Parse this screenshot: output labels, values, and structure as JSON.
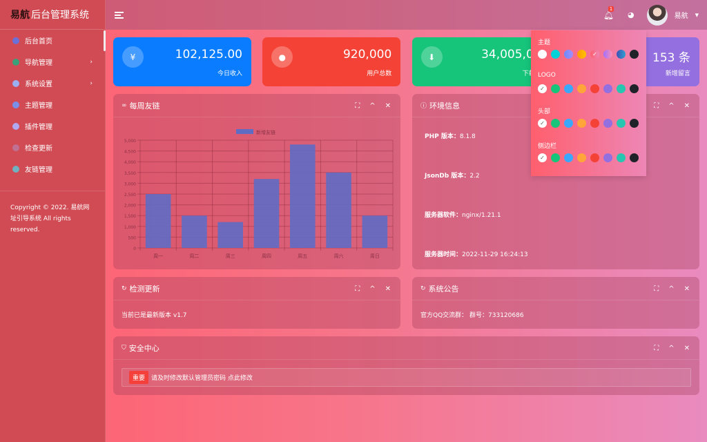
{
  "sidebar": {
    "brand": "易航",
    "title": "后台管理系统",
    "items": [
      {
        "label": "后台首页",
        "icon": "home-icon",
        "color": "#6b70d8"
      },
      {
        "label": "导航管理",
        "icon": "navigation-icon",
        "color": "#3aa07a",
        "chevron": "›"
      },
      {
        "label": "系统设置",
        "icon": "settings-icon",
        "color": "#9ab0f0",
        "chevron": "›"
      },
      {
        "label": "主题管理",
        "icon": "theme-icon",
        "color": "#7a8fe8"
      },
      {
        "label": "插件管理",
        "icon": "plugin-icon",
        "color": "#b0a8f0"
      },
      {
        "label": "检查更新",
        "icon": "clock-icon",
        "color": "#c07090"
      },
      {
        "label": "友链管理",
        "icon": "link-icon",
        "color": "#70b0c0"
      }
    ],
    "copyright": "Copyright © 2022. 易航网址引导系统 All rights reserved."
  },
  "header": {
    "notification_count": "1",
    "username": "易航"
  },
  "cards": [
    {
      "value": "102,125.00",
      "label": "今日收入",
      "icon": "yen-icon",
      "glyph": "¥",
      "color": "#0a7cff"
    },
    {
      "value": "920,000",
      "label": "用户总数",
      "icon": "user-icon",
      "glyph": "●",
      "color": "#f44336"
    },
    {
      "value": "34,005,00",
      "label": "下载总",
      "icon": "download-icon",
      "glyph": "⬇",
      "color": "#16c47a"
    },
    {
      "value": "153 条",
      "label": "新增留言",
      "icon": "message-icon",
      "glyph": "✉",
      "color": "#946fe0"
    }
  ],
  "panels": {
    "weekly": "每周友链",
    "env": "环境信息",
    "update": "检测更新",
    "notice": "系统公告",
    "security": "安全中心"
  },
  "env": [
    {
      "key": "PHP 版本：",
      "value": "8.1.8"
    },
    {
      "key": "JsonDb 版本：",
      "value": "2.2"
    },
    {
      "key": "服务器软件：",
      "value": "nginx/1.21.1"
    },
    {
      "key": "服务器时间：",
      "value": "2022-11-29 16:24:13"
    }
  ],
  "update_text": "当前已是最新版本 v1.7",
  "notice_text": "官方QQ交流群：  群号：733120686",
  "security": {
    "tag": "重要",
    "text": "请及时修改默认管理员密码 点此修改"
  },
  "theme_menu": {
    "sections": [
      {
        "title": "主题",
        "colors": [
          "#ffffff",
          "#00d2d8",
          "linear-gradient(90deg,#6a8cff,#a58cff)",
          "linear-gradient(90deg,#ff9a00,#ffc400)",
          "linear-gradient(90deg,#ff5f6d,#ed86b6)",
          "linear-gradient(90deg,#a070ff,#ff8fb0)",
          "linear-gradient(90deg,#3f51b5,#2fa0d0)",
          "#1f2228"
        ],
        "selected": 4
      },
      {
        "title": "LOGO",
        "colors": [
          "#ffffff",
          "#16c47a",
          "#3aa8ff",
          "#ffa53a",
          "#f44336",
          "#946fe0",
          "#26c6b0",
          "#1f2228"
        ],
        "selected": 0
      },
      {
        "title": "头部",
        "colors": [
          "#ffffff",
          "#16c47a",
          "#3aa8ff",
          "#ffa53a",
          "#f44336",
          "#946fe0",
          "#26c6b0",
          "#1f2228"
        ],
        "selected": 0
      },
      {
        "title": "侧边栏",
        "colors": [
          "#ffffff",
          "#16c47a",
          "#3aa8ff",
          "#ffa53a",
          "#f44336",
          "#946fe0",
          "#26c6b0",
          "#1f2228"
        ],
        "selected": 0
      }
    ]
  },
  "chart_data": {
    "type": "bar",
    "categories": [
      "周一",
      "周二",
      "周三",
      "周四",
      "周五",
      "周六",
      "周日"
    ],
    "series": [
      {
        "name": "新增友链",
        "values": [
          2500,
          1500,
          1200,
          3200,
          4800,
          3500,
          1500
        ]
      }
    ],
    "ylim": [
      0,
      5000
    ],
    "yticks": [
      "0",
      "500",
      "1,000",
      "1,500",
      "2,000",
      "2,500",
      "3,000",
      "3,500",
      "4,000",
      "4,500",
      "5,000"
    ],
    "grid": true,
    "legend": "top",
    "color": "#5f6cc4"
  }
}
